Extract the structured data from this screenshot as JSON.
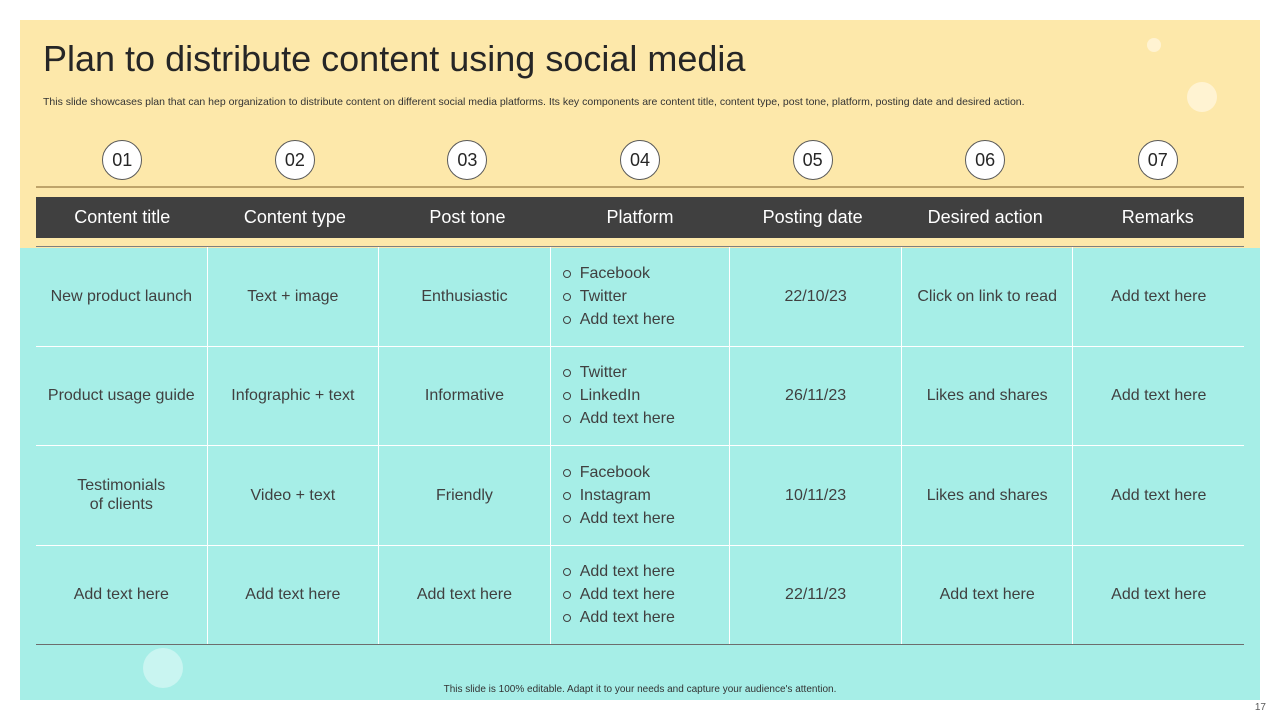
{
  "slide": {
    "title": "Plan to distribute content using social media",
    "subtitle": "This slide showcases plan that can hep organization to distribute content on different social media platforms. Its key components are content title, content type,  post tone, platform, posting date and desired action.",
    "footer": "This slide is 100% editable.  Adapt it to your needs and capture your audience's attention.",
    "page_number": "17",
    "colors": {
      "top_panel": "#fde8aa",
      "bottom_panel": "#a6eee7",
      "header_bar": "#404040",
      "title_text": "#262626"
    }
  },
  "steps": [
    "01",
    "02",
    "03",
    "04",
    "05",
    "06",
    "07"
  ],
  "table": {
    "headers": [
      "Content title",
      "Content type",
      "Post tone",
      "Platform",
      "Posting date",
      "Desired action",
      "Remarks"
    ],
    "rows": [
      {
        "title": "New product launch",
        "type": "Text + image",
        "tone": "Enthusiastic",
        "platforms": [
          "Facebook",
          "Twitter",
          "Add text here"
        ],
        "date": "22/10/23",
        "action": "Click on link to read",
        "remarks": "Add text here"
      },
      {
        "title": "Product usage guide",
        "type": "Infographic  + text",
        "tone": "Informative",
        "platforms": [
          "Twitter",
          "LinkedIn",
          "Add text here"
        ],
        "date": "26/11/23",
        "action": "Likes and shares",
        "remarks": "Add text here"
      },
      {
        "title_line1": "Testimonials",
        "title_line2": "of clients",
        "type": "Video + text",
        "tone": "Friendly",
        "platforms": [
          "Facebook",
          "Instagram",
          "Add text here"
        ],
        "date": "10/11/23",
        "action": "Likes and shares",
        "remarks": "Add text here"
      },
      {
        "title": "Add text here",
        "type": "Add text here",
        "tone": "Add text here",
        "platforms": [
          "Add text here",
          "Add text here",
          "Add text here"
        ],
        "date": "22/11/23",
        "action": "Add text here",
        "remarks": "Add text here"
      }
    ]
  }
}
